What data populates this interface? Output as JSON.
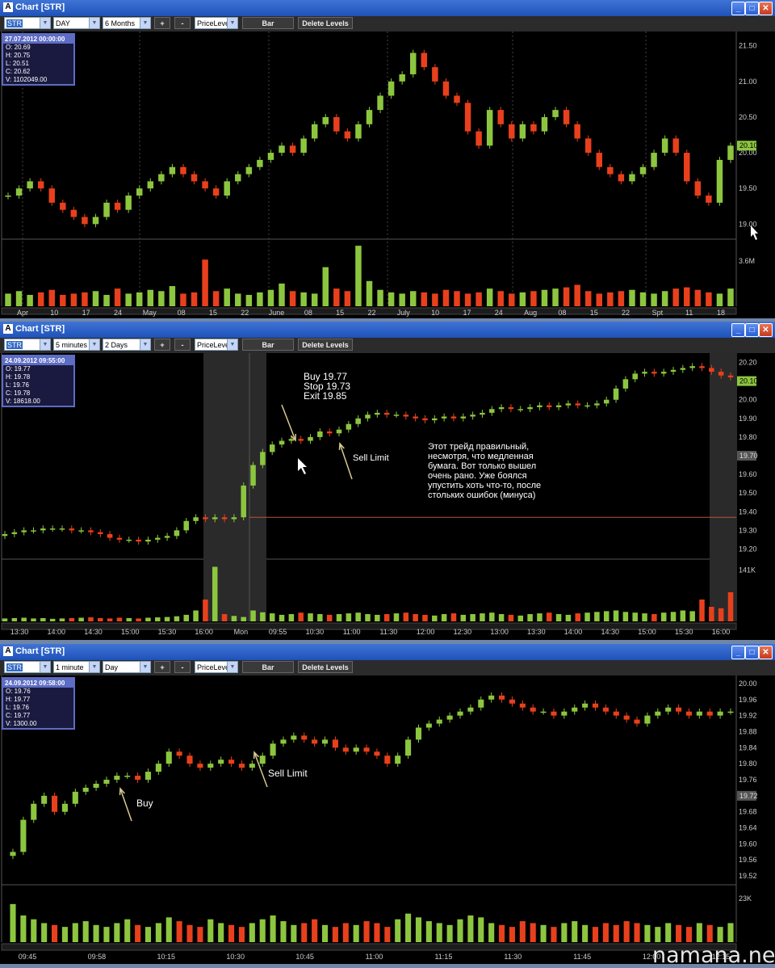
{
  "windows": [
    {
      "title": "Chart [STR]",
      "toolbar": {
        "symbol": "STR",
        "interval": "DAY",
        "range": "6 Months",
        "plus": "+",
        "minus": "-",
        "indicator": "PriceLeve",
        "bar": "Bar",
        "delete": "Delete Levels"
      },
      "info": {
        "date": "27.07.2012 00:00:00",
        "o": "O: 20.69",
        "h": "H: 20.75",
        "l": "L: 20.51",
        "c": "C: 20.62",
        "v": "V: 1102049.00"
      },
      "price_labels": [
        "21.50",
        "21.00",
        "20.50",
        "20.00",
        "19.50",
        "19.00"
      ],
      "last_price": "20.10",
      "volume_label": "3.6M",
      "time_labels": [
        "Apr",
        "10",
        "17",
        "24",
        "May",
        "08",
        "15",
        "22",
        "June",
        "08",
        "15",
        "22",
        "July",
        "10",
        "17",
        "24",
        "Aug",
        "08",
        "15",
        "22",
        "Spt",
        "11",
        "18"
      ]
    },
    {
      "title": "Chart [STR]",
      "toolbar": {
        "symbol": "STR",
        "interval": "5 minutes",
        "range": "2 Days",
        "plus": "+",
        "minus": "-",
        "indicator": "PriceLeve",
        "bar": "Bar",
        "delete": "Delete Levels"
      },
      "info": {
        "date": "24.09.2012 09:55:00",
        "o": "O: 19.77",
        "h": "H: 19.78",
        "l": "L: 19.76",
        "c": "C: 19.78",
        "v": "V: 18618.00"
      },
      "price_labels": [
        "20.20",
        "20.00",
        "19.90",
        "19.80",
        "19.60",
        "19.50",
        "19.40",
        "19.30",
        "19.20"
      ],
      "last_price": "20.10",
      "cursor_price": "19.70",
      "volume_label": "141K",
      "time_labels": [
        "13:30",
        "14:00",
        "14:30",
        "15:00",
        "15:30",
        "16:00",
        "Mon",
        "09:55",
        "10:30",
        "11:00",
        "11:30",
        "12:00",
        "12:30",
        "13:00",
        "13:30",
        "14:00",
        "14:30",
        "15:00",
        "15:30",
        "16:00"
      ],
      "annotations": {
        "trade": "Buy 19.77\nStop 19.73\nExit 19.85",
        "sell": "Sell Limit",
        "comment": "Этот трейд правильный,\nнесмотря, что медленная\nбумага. Вот только вышел\nочень рано. Уже боялся\nупустить хоть что-то, после\nстольких ошибок (минуса)"
      }
    },
    {
      "title": "Chart [STR]",
      "toolbar": {
        "symbol": "STR",
        "interval": "1 minute",
        "range": "Day",
        "plus": "+",
        "minus": "-",
        "indicator": "PriceLeve",
        "bar": "Bar",
        "delete": "Delete Levels"
      },
      "info": {
        "date": "24.09.2012 09:58:00",
        "o": "O: 19.76",
        "h": "H: 19.77",
        "l": "L: 19.76",
        "c": "C: 19.77",
        "v": "V: 1300.00"
      },
      "price_labels": [
        "20.00",
        "19.96",
        "19.92",
        "19.88",
        "19.84",
        "19.80",
        "19.76",
        "19.72",
        "19.68",
        "19.64",
        "19.60",
        "19.56",
        "19.52"
      ],
      "cursor_price": "19.72",
      "volume_label": "23K",
      "time_labels": [
        "09:45",
        "09:58",
        "10:15",
        "10:30",
        "10:45",
        "11:00",
        "11:15",
        "11:30",
        "11:45",
        "12:00",
        "12:15"
      ],
      "annotations": {
        "buy": "Buy",
        "sell": "Sell Limit"
      }
    }
  ],
  "watermark": "namana.net",
  "colors": {
    "up": "#8cc63f",
    "down": "#e8401c",
    "title": "#2a5fd0",
    "grid": "#333333",
    "level": "#b5553a"
  },
  "chart_data": [
    {
      "type": "candlestick",
      "title": "Chart [STR]",
      "interval": "DAY",
      "ylim": [
        18.8,
        21.7
      ],
      "y_ticks": [
        19.0,
        19.5,
        20.0,
        20.5,
        21.0,
        21.5
      ],
      "x_tick_labels": [
        "Apr",
        "10",
        "17",
        "24",
        "May",
        "08",
        "15",
        "22",
        "June",
        "08",
        "15",
        "22",
        "July",
        "10",
        "17",
        "24",
        "Aug",
        "08",
        "15",
        "22",
        "Spt",
        "11",
        "18"
      ],
      "close": [
        19.4,
        19.5,
        19.6,
        19.5,
        19.3,
        19.2,
        19.1,
        19.0,
        19.1,
        19.3,
        19.2,
        19.4,
        19.5,
        19.6,
        19.7,
        19.8,
        19.7,
        19.6,
        19.5,
        19.4,
        19.6,
        19.7,
        19.8,
        19.9,
        20.0,
        20.1,
        20.0,
        20.2,
        20.4,
        20.5,
        20.3,
        20.2,
        20.4,
        20.6,
        20.8,
        21.0,
        21.1,
        21.4,
        21.2,
        21.0,
        20.8,
        20.7,
        20.3,
        20.1,
        20.6,
        20.4,
        20.2,
        20.4,
        20.3,
        20.5,
        20.6,
        20.4,
        20.2,
        20.0,
        19.8,
        19.7,
        19.6,
        19.7,
        19.8,
        20.0,
        20.2,
        20.0,
        19.6,
        19.4,
        19.3,
        19.9,
        20.1
      ],
      "volume_millions": [
        1.0,
        1.2,
        0.9,
        1.1,
        1.3,
        0.9,
        1.0,
        1.1,
        1.2,
        0.9,
        1.4,
        1.0,
        1.1,
        1.3,
        1.2,
        1.6,
        1.0,
        1.1,
        3.7,
        1.2,
        1.4,
        1.0,
        0.9,
        1.1,
        1.3,
        1.8,
        1.2,
        1.1,
        1.0,
        3.1,
        1.4,
        1.2,
        4.8,
        2.0,
        1.3,
        1.1,
        1.0,
        1.2,
        1.1,
        1.0,
        1.3,
        1.2,
        1.0,
        1.1,
        1.4,
        1.2,
        1.0,
        1.1,
        1.2,
        1.3,
        1.4,
        1.5,
        1.7,
        1.2,
        1.0,
        1.1,
        1.2,
        1.3,
        1.1,
        1.0,
        1.2,
        1.4,
        1.5,
        1.3,
        1.1,
        1.0,
        1.4
      ]
    },
    {
      "type": "candlestick",
      "title": "Chart [STR]",
      "interval": "5 minutes",
      "ylim": [
        19.15,
        20.25
      ],
      "y_ticks": [
        19.2,
        19.3,
        19.4,
        19.5,
        19.6,
        19.7,
        19.8,
        19.9,
        20.0,
        20.1,
        20.2
      ],
      "level": 19.37,
      "close": [
        19.28,
        19.29,
        19.3,
        19.3,
        19.31,
        19.31,
        19.31,
        19.3,
        19.3,
        19.29,
        19.28,
        19.26,
        19.25,
        19.25,
        19.24,
        19.25,
        19.26,
        19.27,
        19.3,
        19.35,
        19.37,
        19.36,
        19.37,
        19.36,
        19.37,
        19.54,
        19.65,
        19.72,
        19.76,
        19.78,
        19.79,
        19.78,
        19.8,
        19.83,
        19.82,
        19.84,
        19.87,
        19.9,
        19.92,
        19.93,
        19.92,
        19.92,
        19.91,
        19.9,
        19.89,
        19.9,
        19.91,
        19.9,
        19.91,
        19.92,
        19.93,
        19.95,
        19.96,
        19.95,
        19.95,
        19.96,
        19.97,
        19.96,
        19.97,
        19.98,
        19.97,
        19.97,
        19.98,
        20.0,
        20.06,
        20.11,
        20.14,
        20.15,
        20.14,
        20.15,
        20.16,
        20.17,
        20.18,
        20.17,
        20.15,
        20.13,
        20.12
      ],
      "volume_thousands": [
        8,
        9,
        10,
        8,
        9,
        7,
        8,
        9,
        10,
        11,
        9,
        8,
        10,
        9,
        8,
        10,
        11,
        12,
        14,
        18,
        30,
        60,
        150,
        20,
        15,
        12,
        30,
        25,
        22,
        18,
        20,
        24,
        22,
        20,
        18,
        20,
        22,
        24,
        20,
        18,
        20,
        22,
        24,
        20,
        18,
        16,
        20,
        22,
        18,
        20,
        22,
        24,
        20,
        18,
        16,
        20,
        22,
        24,
        20,
        18,
        22,
        24,
        26,
        28,
        30,
        26,
        24,
        22,
        20,
        24,
        26,
        30,
        28,
        60,
        40,
        36,
        80
      ]
    },
    {
      "type": "candlestick",
      "title": "Chart [STR]",
      "interval": "1 minute",
      "ylim": [
        19.5,
        20.02
      ],
      "y_ticks": [
        19.52,
        19.56,
        19.6,
        19.64,
        19.68,
        19.72,
        19.76,
        19.8,
        19.84,
        19.88,
        19.92,
        19.96,
        20.0
      ],
      "close": [
        19.58,
        19.66,
        19.7,
        19.72,
        19.68,
        19.7,
        19.73,
        19.74,
        19.75,
        19.76,
        19.77,
        19.77,
        19.76,
        19.78,
        19.8,
        19.83,
        19.82,
        19.8,
        19.79,
        19.8,
        19.81,
        19.8,
        19.79,
        19.8,
        19.82,
        19.85,
        19.86,
        19.87,
        19.86,
        19.85,
        19.86,
        19.84,
        19.83,
        19.84,
        19.83,
        19.82,
        19.8,
        19.82,
        19.86,
        19.89,
        19.9,
        19.91,
        19.92,
        19.93,
        19.94,
        19.96,
        19.97,
        19.96,
        19.95,
        19.94,
        19.93,
        19.93,
        19.92,
        19.93,
        19.94,
        19.95,
        19.94,
        19.93,
        19.92,
        19.91,
        19.9,
        19.92,
        19.93,
        19.94,
        19.93,
        19.92,
        19.93,
        19.92,
        19.93,
        19.93
      ],
      "volume_thousands": [
        20,
        14,
        12,
        10,
        9,
        8,
        10,
        11,
        9,
        8,
        10,
        12,
        9,
        8,
        10,
        13,
        11,
        9,
        8,
        12,
        10,
        9,
        8,
        10,
        12,
        14,
        11,
        9,
        10,
        12,
        9,
        8,
        10,
        9,
        11,
        10,
        8,
        12,
        15,
        13,
        11,
        10,
        9,
        12,
        14,
        13,
        10,
        9,
        8,
        11,
        10,
        9,
        8,
        10,
        11,
        9,
        8,
        10,
        9,
        11,
        10,
        9,
        8,
        10,
        9,
        8,
        10,
        9,
        8,
        10
      ]
    }
  ]
}
